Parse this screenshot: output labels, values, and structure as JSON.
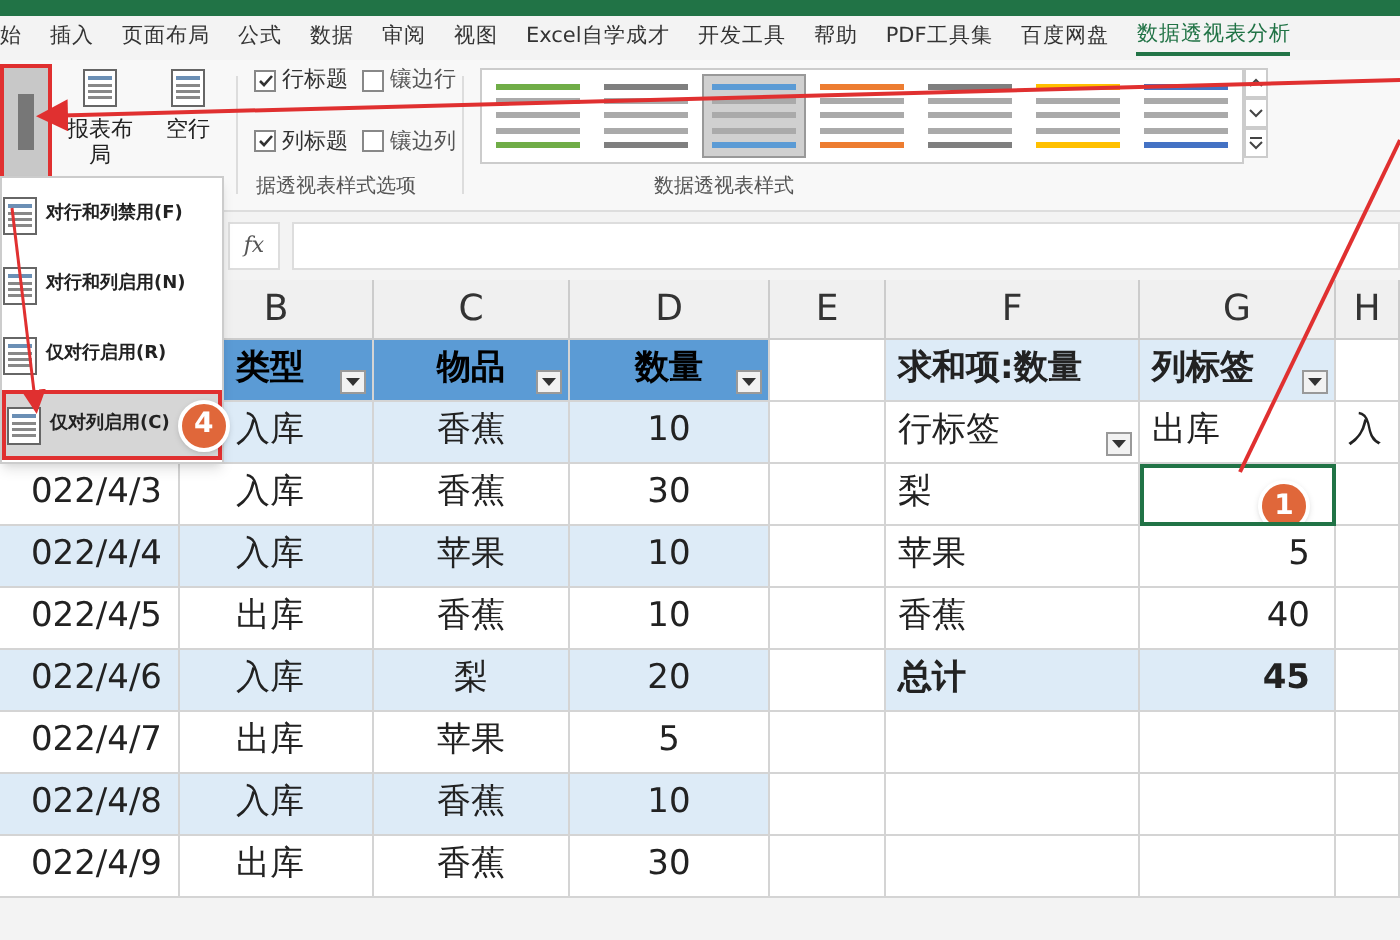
{
  "tabs": [
    {
      "label": "始",
      "selected": false
    },
    {
      "label": "插入",
      "selected": false
    },
    {
      "label": "页面布局",
      "selected": false
    },
    {
      "label": "公式",
      "selected": false
    },
    {
      "label": "数据",
      "selected": false
    },
    {
      "label": "审阅",
      "selected": false
    },
    {
      "label": "视图",
      "selected": false
    },
    {
      "label": "Excel自学成才",
      "selected": false
    },
    {
      "label": "开发工具",
      "selected": false
    },
    {
      "label": "帮助",
      "selected": false
    },
    {
      "label": "PDF工具集",
      "selected": false
    },
    {
      "label": "百度网盘",
      "selected": false
    },
    {
      "label": "数据透视表分析",
      "selected": true
    }
  ],
  "ribbon": {
    "big_buttons": [
      "报表布局",
      "空行"
    ],
    "checkboxes": [
      {
        "label": "行标题",
        "checked": true
      },
      {
        "label": "镶边行",
        "checked": false
      },
      {
        "label": "列标题",
        "checked": true
      },
      {
        "label": "镶边列",
        "checked": false
      }
    ],
    "options_group_label": "据透视表样式选项",
    "styles": [
      {
        "color": "#70ad47",
        "selected": false
      },
      {
        "color": "#7f7f7f",
        "selected": false
      },
      {
        "color": "#5b9bd5",
        "selected": true
      },
      {
        "color": "#ed7d31",
        "selected": false
      },
      {
        "color": "#7f7f7f",
        "selected": false
      },
      {
        "color": "#ffc000",
        "selected": false
      },
      {
        "color": "#4472c4",
        "selected": false
      }
    ],
    "styles_group_label": "数据透视表样式"
  },
  "formula_bar": {
    "fx": "fx"
  },
  "menu": {
    "items": [
      {
        "label": "对行和列禁用(F)",
        "selected": false
      },
      {
        "label": "对行和列启用(N)",
        "selected": false
      },
      {
        "label": "仅对行启用(R)",
        "selected": false
      },
      {
        "label": "仅对列启用(C)",
        "selected": true
      }
    ],
    "badge": "4"
  },
  "columns": [
    "B",
    "C",
    "D",
    "E",
    "F",
    "G",
    "H"
  ],
  "rows": [
    {
      "cells": {
        "B": {
          "text": "类型",
          "header": true,
          "filter": true
        },
        "C": {
          "text": "物品",
          "header": true,
          "filter": true
        },
        "D": {
          "text": "数量",
          "header": true,
          "filter": true
        },
        "F": {
          "text": "求和项:数量",
          "bold": true,
          "banded": true
        },
        "G": {
          "text": "列标签",
          "bold": true,
          "banded": true,
          "filter": true
        }
      }
    },
    {
      "cells": {
        "B": {
          "text": "入库",
          "banded": true
        },
        "C": {
          "text": "香蕉",
          "banded": true
        },
        "D": {
          "text": "10",
          "banded": true
        },
        "F": {
          "text": "行标签",
          "filter": true
        },
        "G": {
          "text": "出库"
        },
        "H": {
          "text": "入"
        }
      }
    },
    {
      "cells": {
        "A": {
          "text": "022/4/3"
        },
        "B": {
          "text": "入库"
        },
        "C": {
          "text": "香蕉"
        },
        "D": {
          "text": "30"
        },
        "F": {
          "text": "梨"
        },
        "G": {
          "active": true,
          "badge": "1"
        }
      }
    },
    {
      "cells": {
        "A": {
          "text": "022/4/4",
          "banded": true
        },
        "B": {
          "text": "入库",
          "banded": true
        },
        "C": {
          "text": "苹果",
          "banded": true
        },
        "D": {
          "text": "10",
          "banded": true
        },
        "F": {
          "text": "苹果"
        },
        "G": {
          "text": "5"
        }
      }
    },
    {
      "cells": {
        "A": {
          "text": "022/4/5"
        },
        "B": {
          "text": "出库"
        },
        "C": {
          "text": "香蕉"
        },
        "D": {
          "text": "10"
        },
        "F": {
          "text": "香蕉"
        },
        "G": {
          "text": "40"
        }
      }
    },
    {
      "cells": {
        "A": {
          "text": "022/4/6",
          "banded": true
        },
        "B": {
          "text": "入库",
          "banded": true
        },
        "C": {
          "text": "梨",
          "banded": true
        },
        "D": {
          "text": "20",
          "banded": true
        },
        "F": {
          "text": "总计",
          "bold": true,
          "banded": true
        },
        "G": {
          "text": "45",
          "bold": true,
          "banded": true
        }
      }
    },
    {
      "cells": {
        "A": {
          "text": "022/4/7"
        },
        "B": {
          "text": "出库"
        },
        "C": {
          "text": "苹果"
        },
        "D": {
          "text": "5"
        }
      }
    },
    {
      "cells": {
        "A": {
          "text": "022/4/8",
          "banded": true
        },
        "B": {
          "text": "入库",
          "banded": true
        },
        "C": {
          "text": "香蕉",
          "banded": true
        },
        "D": {
          "text": "10",
          "banded": true
        }
      }
    },
    {
      "cells": {
        "A": {
          "text": "022/4/9"
        },
        "B": {
          "text": "出库"
        },
        "C": {
          "text": "香蕉"
        },
        "D": {
          "text": "30"
        }
      }
    }
  ]
}
